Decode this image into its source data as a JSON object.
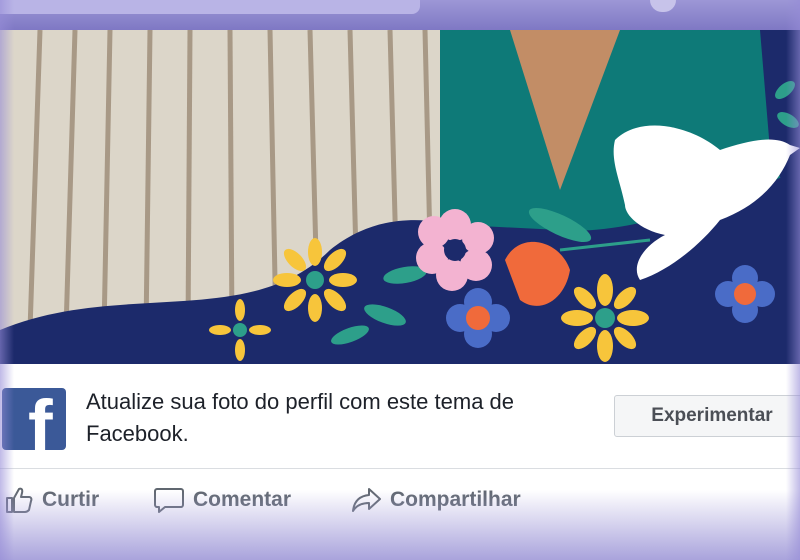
{
  "promo": {
    "message": "Atualize sua foto do perfil com este tema de Facebook.",
    "button_label": "Experimentar",
    "logo_letter": "f"
  },
  "actions": {
    "like_label": "Curtir",
    "comment_label": "Comentar",
    "share_label": "Compartilhar"
  },
  "colors": {
    "facebook_blue": "#3b5998",
    "frame_navy": "#1c2a6b",
    "frame_teal": "#0d7c7a"
  },
  "icons": [
    "facebook-logo-icon",
    "thumbs-up-icon",
    "comment-icon",
    "share-icon"
  ]
}
